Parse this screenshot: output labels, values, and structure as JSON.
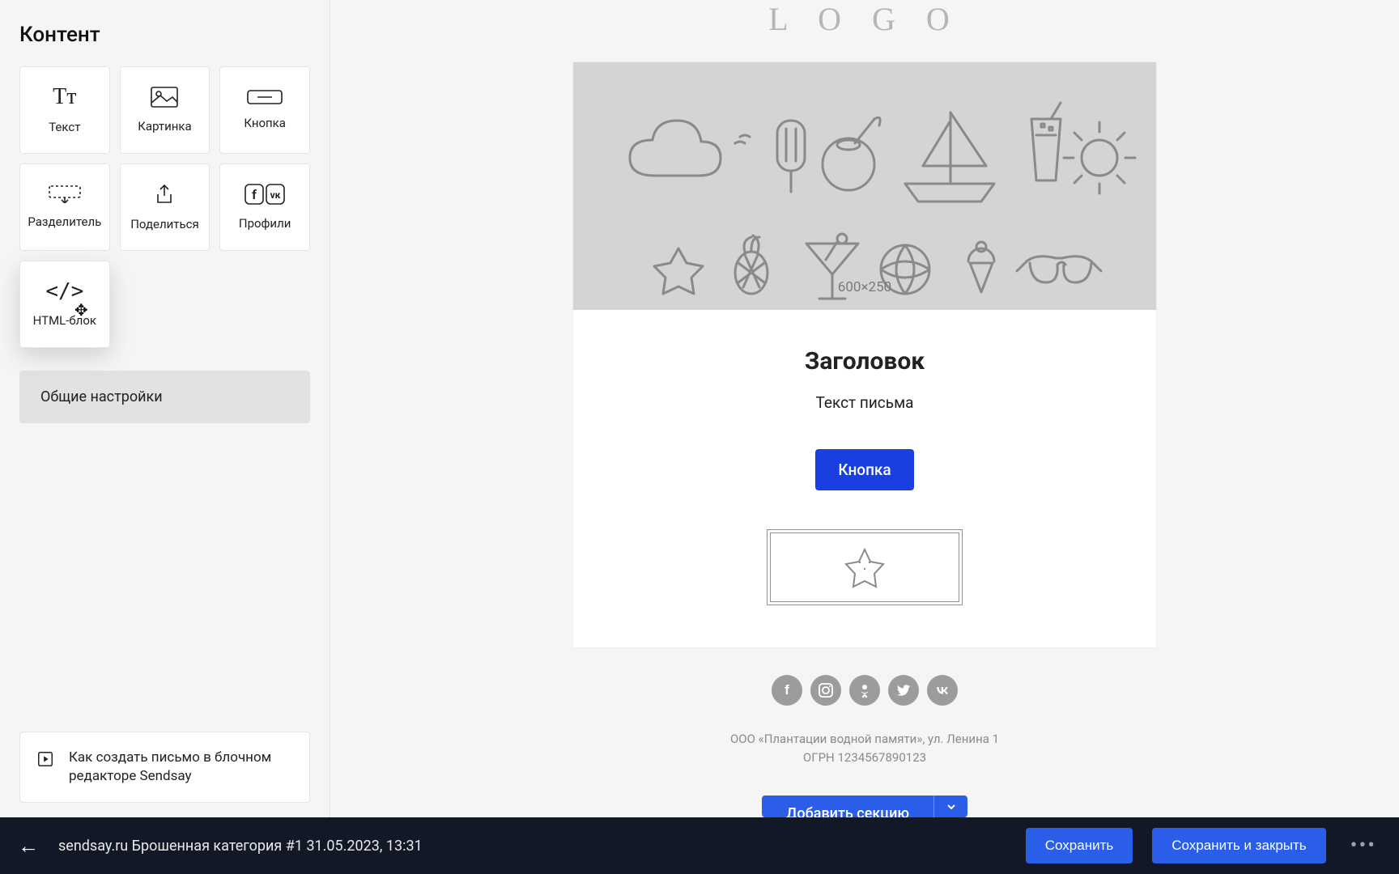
{
  "sidebar": {
    "title": "Контент",
    "blocks": [
      {
        "name": "text",
        "label": "Текст"
      },
      {
        "name": "image",
        "label": "Картинка"
      },
      {
        "name": "button",
        "label": "Кнопка"
      },
      {
        "name": "divider",
        "label": "Разделитель"
      },
      {
        "name": "share",
        "label": "Поделиться"
      },
      {
        "name": "profiles",
        "label": "Профили"
      },
      {
        "name": "html",
        "label": "HTML-блок"
      }
    ],
    "settings_label": "Общие настройки",
    "help_text": "Как создать письмо в блочном редакторе Sendsay"
  },
  "canvas": {
    "logo_text": "L O G O",
    "hero_size_label": "600×250",
    "heading": "Заголовок",
    "body": "Текст письма",
    "cta": "Кнопка",
    "legal_line1": "ООО «Плантации водной памяти», ул. Ленина 1",
    "legal_line2": "ОГРН 1234567890123",
    "add_section_label": "Добавить секцию"
  },
  "bottombar": {
    "doc_title": "sendsay.ru Брошенная категория #1 31.05.2023, 13:31",
    "save": "Сохранить",
    "save_close": "Сохранить и закрыть"
  },
  "icons": {
    "social": [
      "facebook",
      "instagram",
      "odnoklassniki",
      "twitter",
      "vk"
    ]
  }
}
